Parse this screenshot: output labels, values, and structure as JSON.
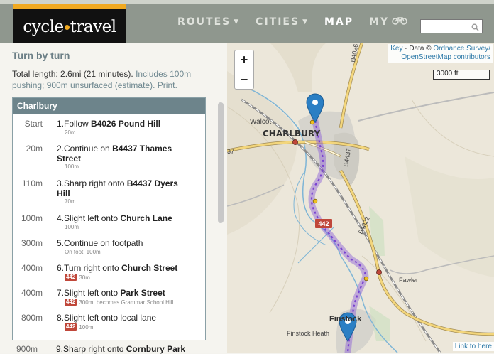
{
  "header": {
    "logo_left": "cycle",
    "logo_right": "travel",
    "nav": [
      {
        "label": "ROUTES",
        "has_caret": true
      },
      {
        "label": "CITIES",
        "has_caret": true
      },
      {
        "label": "MAP",
        "has_caret": false
      },
      {
        "label": "MY",
        "has_caret": false
      }
    ],
    "search_placeholder": ""
  },
  "panel": {
    "title": "Turn by turn",
    "summary_dark": "Total length: 2.6mi (21 minutes).",
    "summary_muted": " Includes 100m pushing; 900m unsurfaced (estimate).",
    "print_label": "Print.",
    "section": "Charlbury",
    "steps": [
      {
        "dist": "Start",
        "num": "1.",
        "pre": "Follow ",
        "bold": "B4026 Pound Hill",
        "post": "",
        "badge": "",
        "sub": "20m"
      },
      {
        "dist": "20m",
        "num": "2.",
        "pre": "Continue on ",
        "bold": "B4437 Thames Street",
        "post": "",
        "badge": "",
        "sub": "100m"
      },
      {
        "dist": "110m",
        "num": "3.",
        "pre": "Sharp right onto ",
        "bold": "B4437 Dyers Hill",
        "post": "",
        "badge": "",
        "sub": "70m"
      },
      {
        "dist": "100m",
        "num": "4.",
        "pre": "Slight left onto ",
        "bold": "Church Lane",
        "post": "",
        "badge": "",
        "sub": "100m"
      },
      {
        "dist": "300m",
        "num": "5.",
        "pre": "Continue on footpath",
        "bold": "",
        "post": "",
        "badge": "",
        "sub": "On foot; 100m"
      },
      {
        "dist": "400m",
        "num": "6.",
        "pre": "Turn right onto ",
        "bold": "Church Street",
        "post": "",
        "badge": "442",
        "sub": "30m"
      },
      {
        "dist": "400m",
        "num": "7.",
        "pre": "Slight left onto ",
        "bold": "Park Street",
        "post": "",
        "badge": "442",
        "sub": "300m; becomes Grammar School Hill"
      },
      {
        "dist": "800m",
        "num": "8.",
        "pre": "Slight left onto local lane",
        "bold": "",
        "post": "",
        "badge": "442",
        "sub": "100m"
      }
    ],
    "step9": {
      "dist": "900m",
      "num": "9.",
      "pre": "Sharp right onto ",
      "bold": "Cornbury Park"
    }
  },
  "map": {
    "zoom_in": "+",
    "zoom_out": "−",
    "attrib_key": "Key",
    "attrib_mid": " · Data © ",
    "attrib_os": "Ordnance Survey/",
    "attrib_osm": "OpenStreetMap contributors",
    "scale": "3000 ft",
    "link_here": "Link to here",
    "labels": {
      "charlbury": "CHARLBURY",
      "walcot": "Walcot",
      "fawler": "Fawler",
      "finstock": "Finstock",
      "finstock_heath": "Finstock Heath",
      "b4026": "B4026",
      "b4437": "B4437",
      "b4022": "B4022",
      "route_badge": "442",
      "edge_37": "37"
    },
    "colors": {
      "route": "#8a5ad8",
      "pin": "#2b7fc4",
      "road": "#f3d67c"
    }
  }
}
